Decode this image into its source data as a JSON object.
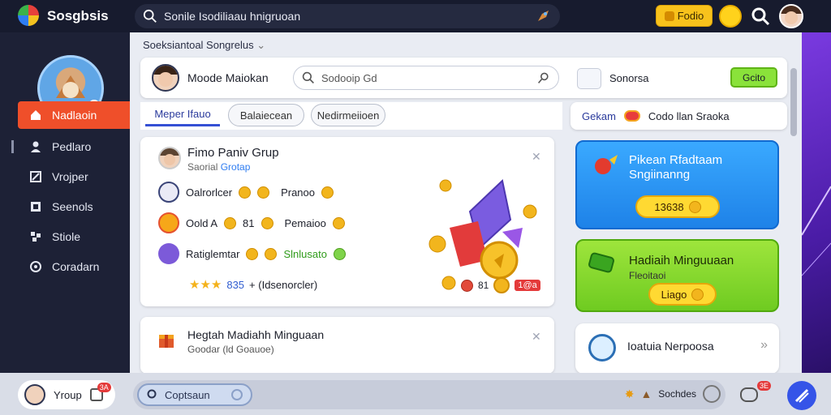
{
  "topbar": {
    "app_title": "Sosgbsis",
    "search_text": "Sonile Isodiliaau hnigruoan",
    "premium_label": "Fodio"
  },
  "sidebar": {
    "items": [
      {
        "label": "Nadlaoin",
        "icon": "home-icon"
      },
      {
        "label": "Pedlaro",
        "icon": "user-icon"
      },
      {
        "label": "Vrojper",
        "icon": "flag-icon"
      },
      {
        "label": "Seenols",
        "icon": "square-icon"
      },
      {
        "label": "Stiole",
        "icon": "puzzle-icon"
      },
      {
        "label": "Coradarn",
        "icon": "settings-icon"
      }
    ]
  },
  "breadcrumb": "Soeksiantoal Songrelus",
  "header": {
    "user_name": "Moode Maiokan",
    "search_text": "Sodooip Gd",
    "sonsa_label": "Sonorsa",
    "green_button": "Gcito"
  },
  "tabs": [
    {
      "label": "Meper Ifauo"
    },
    {
      "label": "Balaiecean"
    },
    {
      "label": "Nedirmeiioen"
    }
  ],
  "side_link": {
    "link_text": "Gekam",
    "label": "Codo llan Sraoka"
  },
  "group_card": {
    "title": "Fimo Paniv Grup",
    "sub_prefix": "Saorial",
    "sub_link": "Grotap",
    "rows": [
      {
        "label": "Oalrorlcer",
        "extra": "Pranoo"
      },
      {
        "label": "Oold A",
        "value": "81",
        "extra": "Pemaioo"
      },
      {
        "label": "Ratiglemtar",
        "extra": "Slnlusato"
      }
    ],
    "stars_value": "835",
    "stars_text": "+ (Idsenorcler)",
    "bottom_value": "81",
    "bottom_badge": "1@a"
  },
  "second_card": {
    "title": "Hegtah Madiahh Minguaan",
    "sub": "Goodar (ld Goauoe)"
  },
  "promo_blue": {
    "title_line1": "Pikean Rfadtaam",
    "title_line2": "Sngiinanng",
    "button_value": "13638"
  },
  "promo_green": {
    "title": "Hadiaih Minguuaan",
    "sub": "Fleoitaoi",
    "button_value": "Liago"
  },
  "promo_white": {
    "title": "Ioatuia Nerpoosa"
  },
  "bottom": {
    "group_label": "Yroup",
    "notif_count": "3A",
    "contact_label": "Coptsaun",
    "right_label": "Sochdes",
    "chat_count": "3E"
  }
}
